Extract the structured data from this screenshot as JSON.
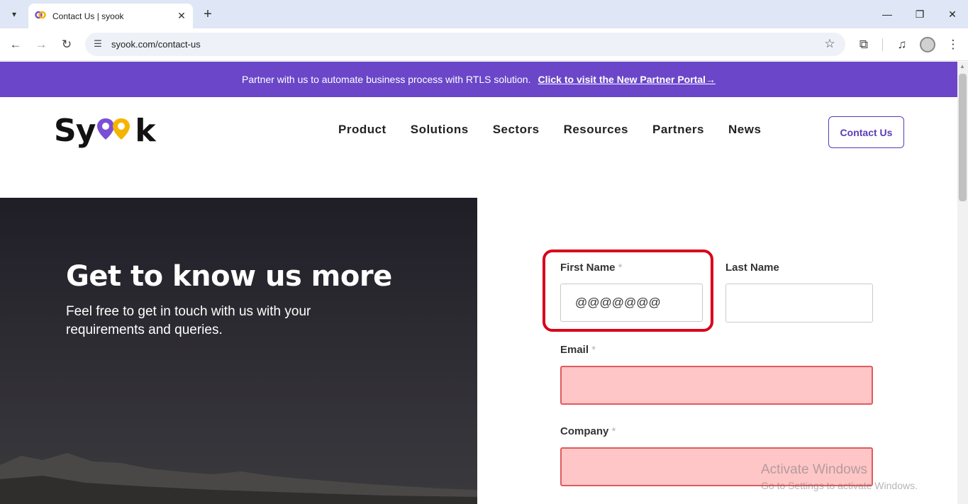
{
  "browser": {
    "tab_title": "Contact Us | syook",
    "url": "syook.com/contact-us"
  },
  "banner": {
    "text": "Partner with us to automate business process with RTLS solution.",
    "link": "Click to visit the New Partner Portal→"
  },
  "header": {
    "logo_text_a": "Sy",
    "logo_text_b": "k",
    "nav": [
      "Product",
      "Solutions",
      "Sectors",
      "Resources",
      "Partners",
      "News"
    ],
    "contact_button": "Contact Us"
  },
  "hero": {
    "title": "Get to know us more",
    "subtitle": "Feel free to get in touch with us with your requirements and queries."
  },
  "form": {
    "first_name_label": "First Name",
    "first_name_value": "@@@@@@@",
    "last_name_label": "Last Name",
    "last_name_value": "",
    "email_label": "Email",
    "email_value": "",
    "company_label": "Company",
    "company_value": "",
    "required_mark": "*"
  },
  "watermark": {
    "line1": "Activate Windows",
    "line2": "Go to Settings to activate Windows."
  },
  "colors": {
    "accent": "#6b46c9",
    "error_fill": "#ffc6c7",
    "highlight": "#d9001b"
  }
}
